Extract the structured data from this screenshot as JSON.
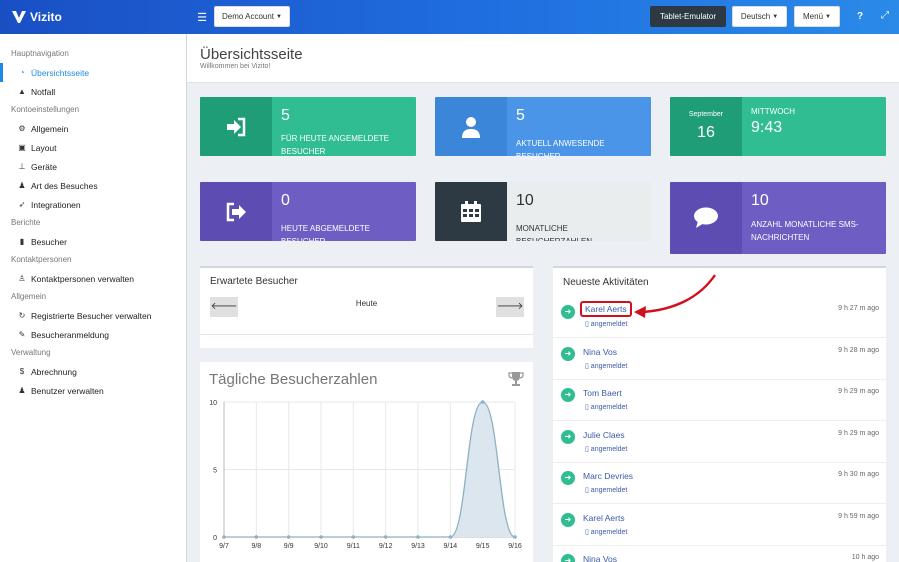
{
  "app": {
    "name": "Vizito"
  },
  "topbar": {
    "account_label": "Demo Account",
    "tablet_label": "Tablet-Emulator",
    "language_label": "Deutsch",
    "menu_label": "Menü",
    "help_icon": "?",
    "expand_icon": "⤢"
  },
  "sidebar": {
    "sections": [
      {
        "header": "Hauptnavigation",
        "items": [
          {
            "label": "Übersichtsseite",
            "icon": "dashboard-icon",
            "glyph": "◔",
            "active": true
          },
          {
            "label": "Notfall",
            "icon": "warning-icon",
            "glyph": "▲"
          }
        ]
      },
      {
        "header": "Kontoeinstellungen",
        "items": [
          {
            "label": "Allgemein",
            "icon": "gear-icon",
            "glyph": "⚙"
          },
          {
            "label": "Layout",
            "icon": "image-icon",
            "glyph": "▣"
          },
          {
            "label": "Geräte",
            "icon": "sitemap-icon",
            "glyph": "⊥"
          },
          {
            "label": "Art des Besuches",
            "icon": "users-icon",
            "glyph": "♟"
          },
          {
            "label": "Integrationen",
            "icon": "rocket-icon",
            "glyph": "➶"
          }
        ]
      },
      {
        "header": "Berichte",
        "items": [
          {
            "label": "Besucher",
            "icon": "book-icon",
            "glyph": "▮"
          }
        ]
      },
      {
        "header": "Kontaktpersonen",
        "items": [
          {
            "label": "Kontaktpersonen verwalten",
            "icon": "person-icon",
            "glyph": "♙"
          }
        ]
      },
      {
        "header": "Allgemein",
        "items": [
          {
            "label": "Registrierte Besucher verwalten",
            "icon": "refresh-icon",
            "glyph": "↻"
          },
          {
            "label": "Besucheranmeldung",
            "icon": "pencil-icon",
            "glyph": "✎"
          }
        ]
      },
      {
        "header": "Verwaltung",
        "items": [
          {
            "label": "Abrechnung",
            "icon": "dollar-icon",
            "glyph": "$"
          },
          {
            "label": "Benutzer verwalten",
            "icon": "user-plus-icon",
            "glyph": "♟"
          }
        ]
      }
    ]
  },
  "header": {
    "title": "Übersichtsseite",
    "subtitle": "Willkommen bei Vizito!"
  },
  "stats": {
    "checked_in": {
      "value": "5",
      "label": "Für heute angemeldete Besucher",
      "color": "#2fbd91"
    },
    "present": {
      "value": "5",
      "label": "Aktuell anwesende Besucher",
      "color": "#4a95e8"
    },
    "date": {
      "month": "September",
      "day": "16",
      "weekday": "Mittwoch",
      "time": "9:43"
    },
    "checked_out": {
      "value": "0",
      "label": "Heute abgemeldete Besucher",
      "color": "#6e5ec4"
    },
    "monthly": {
      "value": "10",
      "label": "Monatliche Besucherzahlen"
    },
    "sms": {
      "value": "10",
      "label": "Anzahl monatliche SMS-Nachrichten"
    }
  },
  "expected": {
    "title": "Erwartete Besucher",
    "day_label": "Heute",
    "prev": "🡐",
    "next": "🡒"
  },
  "activities": {
    "title": "Neueste Aktivitäten",
    "items": [
      {
        "name": "Karel Aerts",
        "status": "angemeldet",
        "time": "9 h 27 m ago",
        "highlighted": true
      },
      {
        "name": "Nina Vos",
        "status": "angemeldet",
        "time": "9 h 28 m ago"
      },
      {
        "name": "Tom Baert",
        "status": "angemeldet",
        "time": "9 h 29 m ago"
      },
      {
        "name": "Julie Claes",
        "status": "angemeldet",
        "time": "9 h 29 m ago"
      },
      {
        "name": "Marc Devries",
        "status": "angemeldet",
        "time": "9 h 30 m ago"
      },
      {
        "name": "Karel Aerts",
        "status": "angemeldet",
        "time": "9 h 59 m ago"
      },
      {
        "name": "Nina Vos",
        "status": "",
        "time": "10 h ago"
      }
    ]
  },
  "chart_data": {
    "type": "area",
    "title": "Tägliche Besucherzahlen",
    "categories": [
      "9/7",
      "9/8",
      "9/9",
      "9/10",
      "9/11",
      "9/12",
      "9/13",
      "9/14",
      "9/15",
      "9/16"
    ],
    "values": [
      0,
      0,
      0,
      0,
      0,
      0,
      0,
      0,
      10,
      0
    ],
    "yticks": [
      0,
      5,
      10
    ],
    "ylim": [
      0,
      10
    ],
    "grid": true,
    "colors": {
      "line": "#8fb0c4",
      "fill": "#dbe6ee"
    }
  }
}
